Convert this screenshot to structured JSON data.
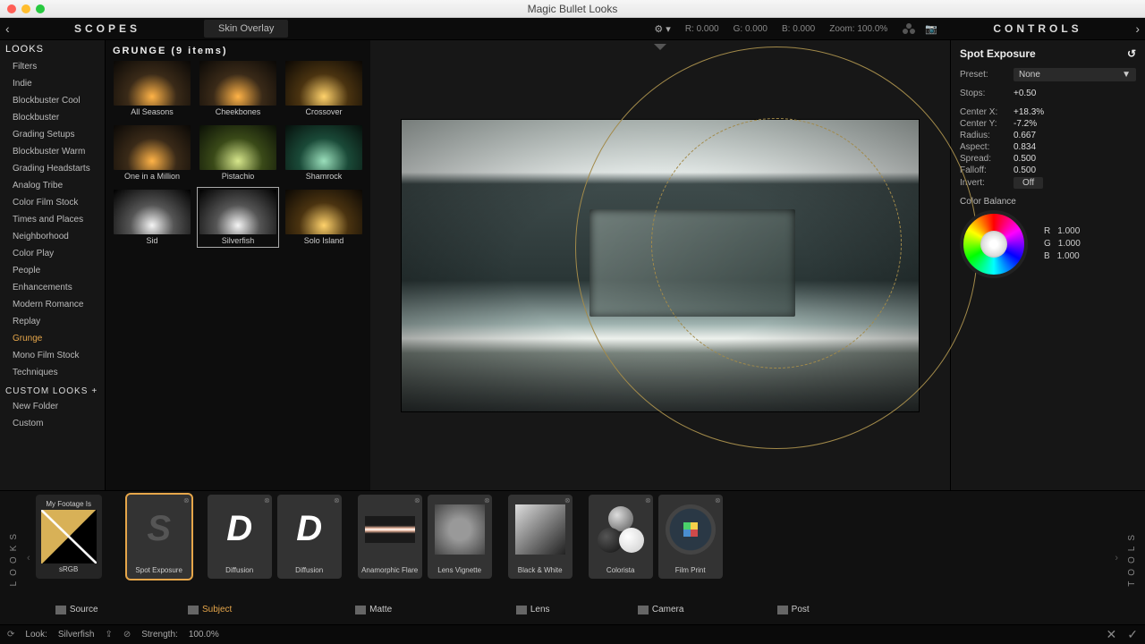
{
  "window_title": "Magic Bullet Looks",
  "top": {
    "scopes": "SCOPES",
    "tab": "Skin Overlay",
    "readout_r": "R: 0.000",
    "readout_g": "G: 0.000",
    "readout_b": "B: 0.000",
    "zoom": "Zoom: 100.0%",
    "controls": "CONTROLS"
  },
  "looks": {
    "header": "LOOKS",
    "items": [
      "Filters",
      "Indie",
      "Blockbuster Cool",
      "Blockbuster",
      "Grading Setups",
      "Blockbuster Warm",
      "Grading Headstarts",
      "Analog Tribe",
      "Color Film Stock",
      "Times and Places",
      "Neighborhood",
      "Color Play",
      "People",
      "Enhancements",
      "Modern Romance",
      "Replay",
      "Grunge",
      "Mono Film Stock",
      "Techniques"
    ],
    "active": "Grunge",
    "custom_header": "CUSTOM LOOKS",
    "custom_items": [
      "New Folder",
      "Custom"
    ]
  },
  "browser": {
    "title": "GRUNGE (9 items)",
    "thumbs": [
      {
        "label": "All Seasons",
        "cls": "t-warm"
      },
      {
        "label": "Cheekbones",
        "cls": "t-warm"
      },
      {
        "label": "Crossover",
        "cls": "t-gold"
      },
      {
        "label": "One in a Million",
        "cls": "t-warm"
      },
      {
        "label": "Pistachio",
        "cls": "t-green"
      },
      {
        "label": "Shamrock",
        "cls": "t-teal"
      },
      {
        "label": "Sid",
        "cls": "t-bw"
      },
      {
        "label": "Silverfish",
        "cls": "t-bw"
      },
      {
        "label": "Solo Island",
        "cls": "t-gold"
      }
    ],
    "selected": "Silverfish"
  },
  "controls": {
    "title": "Spot Exposure",
    "preset_label": "Preset:",
    "preset_value": "None",
    "params": [
      {
        "label": "Stops:",
        "value": "+0.50"
      },
      {
        "label": "Center X:",
        "value": "+18.3%"
      },
      {
        "label": "Center Y:",
        "value": "-7.2%"
      },
      {
        "label": "Radius:",
        "value": "0.667"
      },
      {
        "label": "Aspect:",
        "value": "0.834"
      },
      {
        "label": "Spread:",
        "value": "0.500"
      },
      {
        "label": "Falloff:",
        "value": "0.500"
      }
    ],
    "invert_label": "Invert:",
    "invert_value": "Off",
    "cb_label": "Color Balance",
    "rgb": {
      "r": "1.000",
      "g": "1.000",
      "b": "1.000"
    }
  },
  "chain": {
    "looks_label": "LOOKS",
    "tools_label": "TOOLS",
    "myfootage": "My Footage Is",
    "srgb": "sRGB",
    "source": "Source",
    "subject": {
      "label": "Subject",
      "tools": [
        {
          "name": "Spot Exposure",
          "kind": "spot",
          "sel": true
        }
      ]
    },
    "matte": {
      "label": "Matte",
      "tools": [
        {
          "name": "Diffusion",
          "kind": "D"
        },
        {
          "name": "Diffusion",
          "kind": "D"
        }
      ]
    },
    "lens": {
      "label": "Lens",
      "tools": [
        {
          "name": "Anamorphic Flare",
          "kind": "flare"
        },
        {
          "name": "Lens Vignette",
          "kind": "vign"
        }
      ]
    },
    "camera": {
      "label": "Camera",
      "tools": [
        {
          "name": "Black & White",
          "kind": "bw"
        }
      ]
    },
    "post": {
      "label": "Post",
      "tools": [
        {
          "name": "Colorista",
          "kind": "colorista"
        },
        {
          "name": "Film Print",
          "kind": "film"
        }
      ]
    }
  },
  "status": {
    "look_label": "Look:",
    "look_value": "Silverfish",
    "strength_label": "Strength:",
    "strength_value": "100.0%"
  }
}
